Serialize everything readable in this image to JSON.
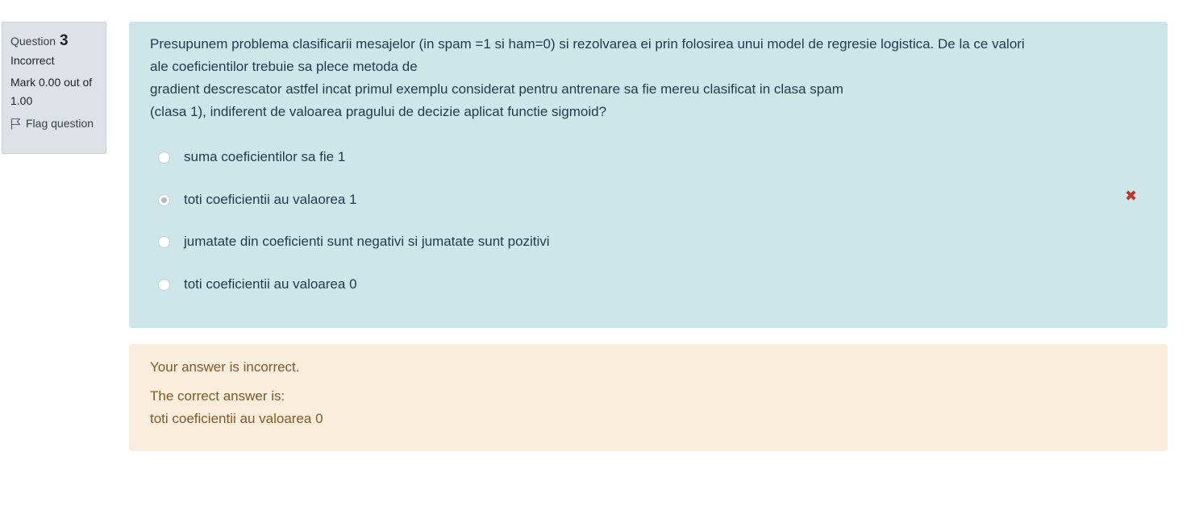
{
  "question_info": {
    "label": "Question",
    "number": "3",
    "state": "Incorrect",
    "grade": "Mark 0.00 out of 1.00",
    "flag_label": "Flag question"
  },
  "question": {
    "lines": [
      "Presupunem problema clasificarii mesajelor (in spam =1 si ham=0) si rezolvarea ei prin folosirea unui model de regresie logistica. De la ce valori ale coeficientilor trebuie sa plece metoda de",
      "gradient descrescator astfel incat primul exemplu considerat pentru antrenare sa fie mereu clasificat in clasa spam",
      "(clasa 1), indiferent de valoarea pragului de decizie aplicat functie sigmoid?"
    ],
    "options": [
      {
        "label": "suma coeficientilor sa fie 1",
        "selected": false
      },
      {
        "label": "toti coeficientii au valaorea 1",
        "selected": true,
        "marked_incorrect": true
      },
      {
        "label": "jumatate din coeficienti sunt negativi si jumatate sunt pozitivi",
        "selected": false
      },
      {
        "label": "toti coeficientii au valoarea 0",
        "selected": false
      }
    ],
    "incorrect_symbol": "✖"
  },
  "feedback": {
    "general": "Your answer is incorrect.",
    "right_answer_intro": "The correct answer is:",
    "right_answer": "toti coeficientii au valoarea 0"
  },
  "colors": {
    "question_bg": "#cce6ea",
    "feedback_bg": "#fbeddb",
    "info_bg": "#dee2e6",
    "incorrect": "#ca3120"
  }
}
